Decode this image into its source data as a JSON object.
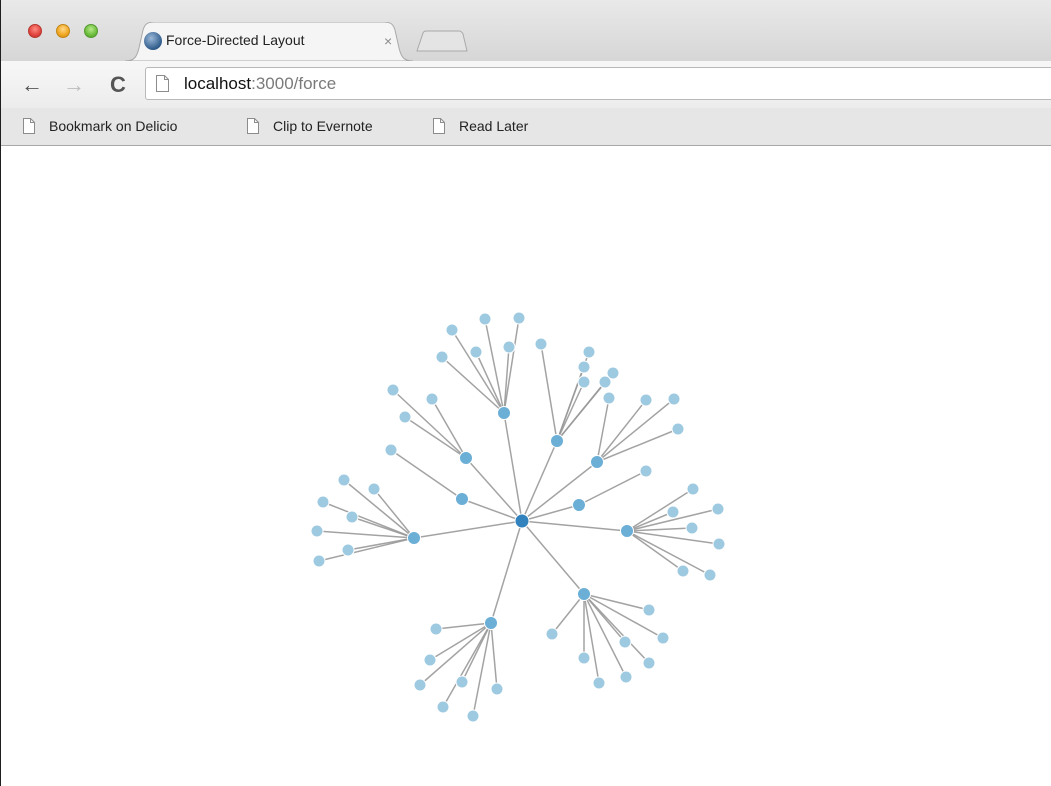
{
  "tab": {
    "title": "Force-Directed Layout",
    "close_glyph": "×",
    "favicon": "d3-logo-icon"
  },
  "toolbar": {
    "back_glyph": "←",
    "forward_glyph": "→",
    "reload_glyph": "C",
    "url_host": "localhost",
    "url_rest": ":3000/force"
  },
  "bookmarks": [
    {
      "label": "Bookmark on Delicio"
    },
    {
      "label": "Clip to Evernote"
    },
    {
      "label": "Read Later"
    }
  ],
  "colors": {
    "root_node": "#3182bd",
    "hub_node": "#6baed6",
    "leaf_node": "#9ecae1",
    "link": "#999999"
  },
  "graph": {
    "root": "root",
    "hubs": [
      {
        "id": "h1",
        "leaves": 6
      },
      {
        "id": "h2",
        "leaves": 3
      },
      {
        "id": "h3",
        "leaves": 6
      },
      {
        "id": "h4",
        "leaves": 4
      },
      {
        "id": "h5",
        "leaves": 1
      },
      {
        "id": "h6",
        "leaves": 1
      },
      {
        "id": "h7",
        "leaves": 7
      },
      {
        "id": "h8",
        "leaves": 10
      },
      {
        "id": "h9",
        "leaves": 7
      },
      {
        "id": "h10",
        "leaves": 10
      },
      {
        "id": "h11",
        "leaves": 11
      }
    ]
  }
}
